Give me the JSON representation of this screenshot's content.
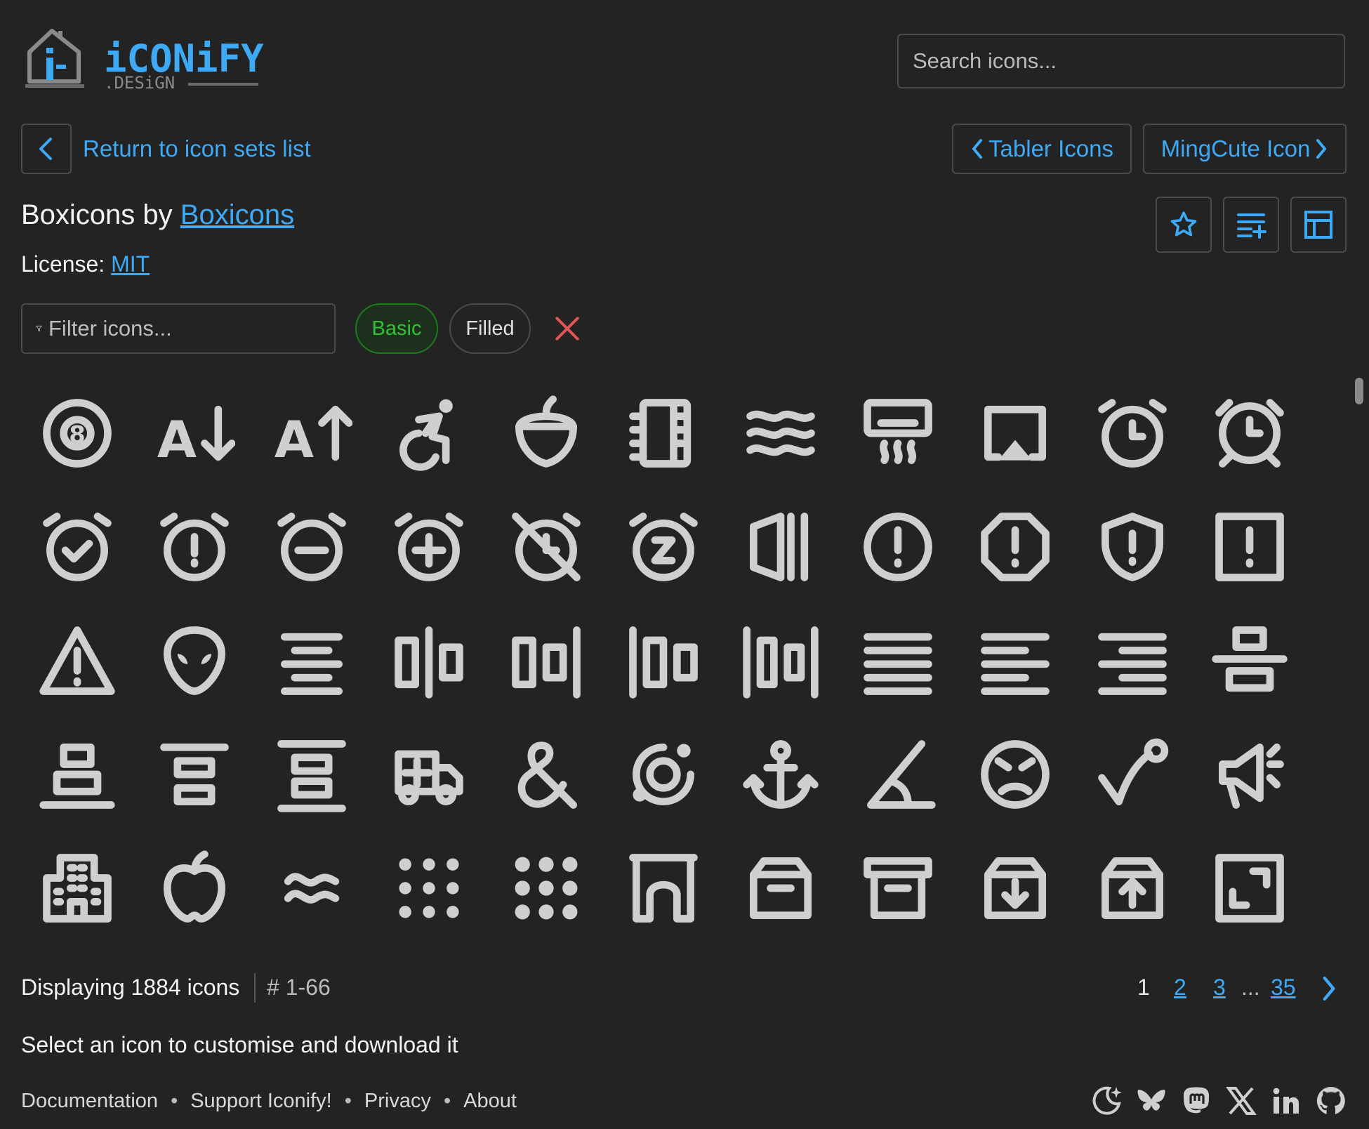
{
  "header": {
    "logo_main": "iCONiFY",
    "logo_sub": ".DESiGN",
    "search_placeholder": "Search icons..."
  },
  "nav": {
    "back_label": "Return to icon sets list",
    "prev_set": "Tabler Icons",
    "next_set": "MingCute Icon"
  },
  "title": {
    "prefix": "Boxicons by ",
    "author": "Boxicons",
    "license_label": "License: ",
    "license": "MIT"
  },
  "filters": {
    "placeholder": "Filter icons...",
    "chips": [
      "Basic",
      "Filled"
    ]
  },
  "icons": [
    "8ball",
    "sort-a-z",
    "sort-z-a",
    "accessibility",
    "acorn",
    "notebook",
    "water",
    "air-conditioner",
    "airplay",
    "alarm",
    "alarm-alt",
    "alarm-check",
    "alarm-exclamation",
    "alarm-minus",
    "alarm-plus",
    "alarm-off",
    "alarm-snooze",
    "album",
    "error-circle",
    "error-octagon",
    "shield-exclamation",
    "error-square",
    "error",
    "alien",
    "align-middle",
    "align-horizontal-center",
    "align-horizontal-right",
    "align-horizontal-left",
    "align-horizontal-spread",
    "align-justify",
    "align-left",
    "align-right",
    "align-vertical-center",
    "align-vertical-bottom",
    "align-vertical-center-alt",
    "align-vertical-top",
    "ambulance",
    "ampersand",
    "analyze",
    "anchor",
    "angle",
    "angry",
    "arrow-from-curve",
    "announcement",
    "building",
    "apple",
    "approximate",
    "apps",
    "apps-alt",
    "arch",
    "archive",
    "archive-alt",
    "archive-in",
    "archive-out",
    "expand"
  ],
  "status": {
    "count": "Displaying 1884 icons",
    "range": "# 1-66",
    "pages": [
      "1",
      "2",
      "3",
      "...",
      "35"
    ]
  },
  "hint": "Select an icon to customise and download it",
  "footer": {
    "links": [
      "Documentation",
      "Support Iconify!",
      "Privacy",
      "About"
    ],
    "socials": [
      "theme-toggle-icon",
      "bluesky-icon",
      "mastodon-icon",
      "x-icon",
      "linkedin-icon",
      "github-icon"
    ]
  },
  "colors": {
    "accent": "#3ea9f5",
    "icon": "#cfcfcf",
    "basic_chip": "#35c135",
    "clear": "#e05555",
    "background": "#232323"
  }
}
